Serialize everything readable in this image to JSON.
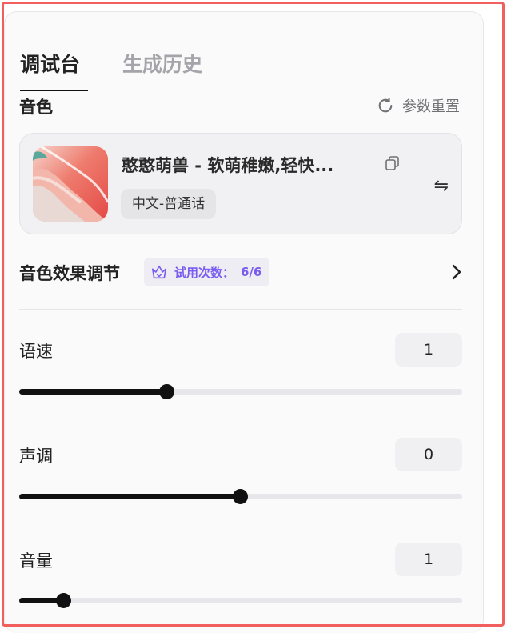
{
  "tabs": {
    "active": "调试台",
    "inactive": "生成历史"
  },
  "voice_section": {
    "title": "音色",
    "reset_label": "参数重置"
  },
  "voice_card": {
    "name": "憨憨萌兽 - 软萌稚嫩,轻快...",
    "language_tag": "中文-普通话",
    "swap_glyph": "⇋"
  },
  "effect": {
    "title": "音色效果调节",
    "trial_label": "试用次数：",
    "trial_count": "6/6"
  },
  "params": [
    {
      "label": "语速",
      "value": "1",
      "fill": 0.332
    },
    {
      "label": "声调",
      "value": "0",
      "fill": 0.499
    },
    {
      "label": "音量",
      "value": "1",
      "fill": 0.099
    }
  ],
  "colors": {
    "accent_purple": "#7b5cf0",
    "frame_red": "#f25f5f",
    "slider_fill": "#111111"
  }
}
